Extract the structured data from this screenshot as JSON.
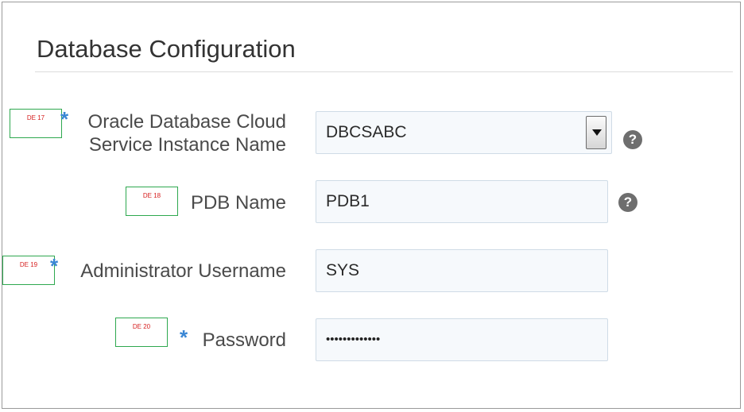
{
  "section": {
    "title": "Database Configuration"
  },
  "fields": {
    "instance": {
      "tag": "DE 17",
      "required": "*",
      "label_line1": "Oracle Database Cloud",
      "label_line2": "Service Instance Name",
      "value": "DBCSABC",
      "help": "?"
    },
    "pdb": {
      "tag": "DE 18",
      "label": "PDB Name",
      "value": "PDB1",
      "help": "?"
    },
    "admin": {
      "tag": "DE 19",
      "required": "*",
      "label": "Administrator Username",
      "value": "SYS"
    },
    "password": {
      "tag": "DE 20",
      "required": "*",
      "label": "Password",
      "value": "•••••••••••••"
    }
  },
  "colors": {
    "required_marker": "#3a86d4",
    "tag_border": "#2ea84f",
    "tag_text": "#d62020",
    "field_bg": "#f6f9fc",
    "field_border": "#cfdbe6"
  },
  "icons": {
    "dropdown": "chevron-down-icon",
    "help": "help-icon"
  }
}
